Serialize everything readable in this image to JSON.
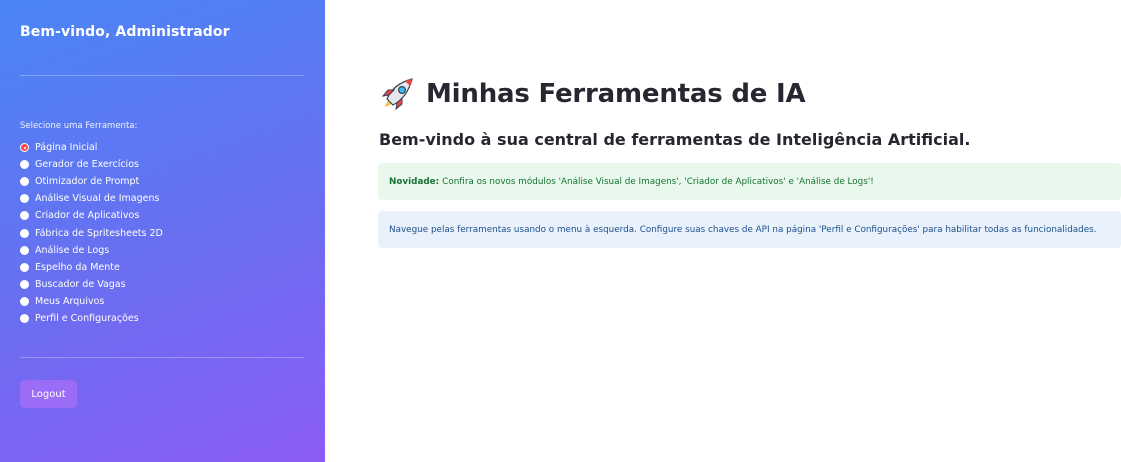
{
  "sidebar": {
    "welcome": "Bem-vindo, Administrador",
    "radio_label": "Selecione uma Ferramenta:",
    "items": [
      {
        "label": "Página Inicial",
        "selected": true
      },
      {
        "label": "Gerador de Exercícios",
        "selected": false
      },
      {
        "label": "Otimizador de Prompt",
        "selected": false
      },
      {
        "label": "Análise Visual de Imagens",
        "selected": false
      },
      {
        "label": "Criador de Aplicativos",
        "selected": false
      },
      {
        "label": "Fábrica de Spritesheets 2D",
        "selected": false
      },
      {
        "label": "Análise de Logs",
        "selected": false
      },
      {
        "label": "Espelho da Mente",
        "selected": false
      },
      {
        "label": "Buscador de Vagas",
        "selected": false
      },
      {
        "label": "Meus Arquivos",
        "selected": false
      },
      {
        "label": "Perfil e Configurações",
        "selected": false
      }
    ],
    "logout_label": "Logout"
  },
  "main": {
    "title_icon": "rocket-icon",
    "title": "Minhas Ferramentas de IA",
    "subtitle": "Bem-vindo à sua central de ferramentas de Inteligência Artificial.",
    "success_alert": {
      "strong": "Novidade:",
      "text": "Confira os novos módulos 'Análise Visual de Imagens', 'Criador de Aplicativos' e 'Análise de Logs'!"
    },
    "info_alert": {
      "text": "Navegue pelas ferramentas usando o menu à esquerda. Configure suas chaves de API na página 'Perfil e Configurações' para habilitar todas as funcionalidades."
    }
  },
  "colors": {
    "sidebar_gradient_start": "#4a86f5",
    "sidebar_gradient_end": "#8b5cf6",
    "selected_radio": "#ff4b4b",
    "logout_button": "#9b6cf5",
    "success_bg": "#e8f8ec",
    "success_text": "#177233",
    "info_bg": "#e9f2fc",
    "info_text": "#1d4f8a",
    "title_text": "#262730"
  }
}
